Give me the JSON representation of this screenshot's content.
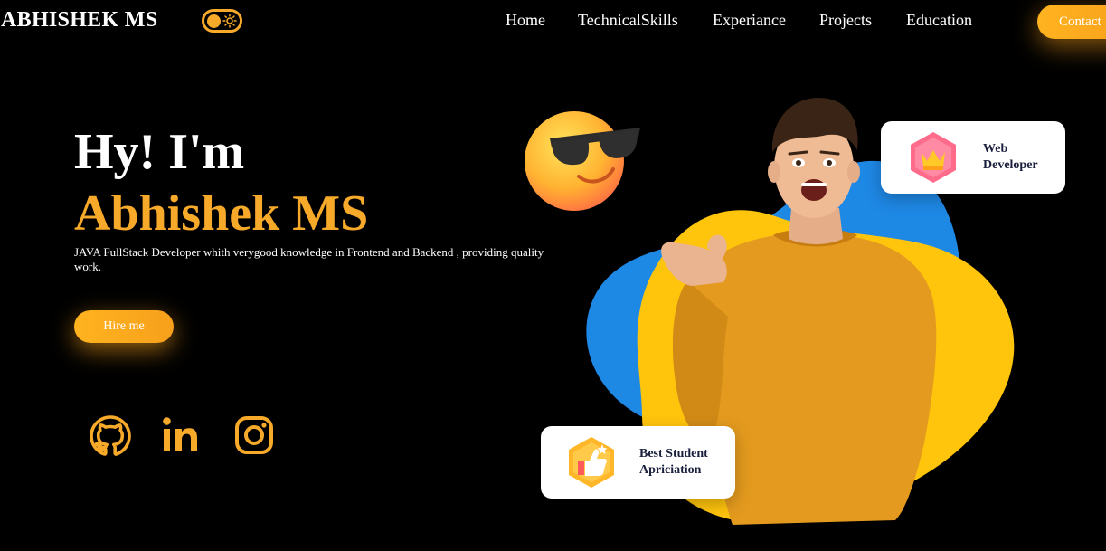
{
  "brand": "ABHISHEK MS",
  "nav": {
    "items": [
      "Home",
      "TechnicalSkills",
      "Experiance",
      "Projects",
      "Education"
    ],
    "contact_label": "Contact"
  },
  "hero": {
    "greeting": "Hy! I'm",
    "name": "Abhishek MS",
    "description": "JAVA FullStack Developer whith verygood knowledge in Frontend and Backend , providing quality work.",
    "hire_label": "Hire me"
  },
  "cards": {
    "web": "Web Developer",
    "student": "Best Student Apriciation"
  },
  "colors": {
    "accent": "#f7a92a",
    "background": "#000000",
    "blob_blue": "#1e88e5",
    "blob_yellow": "#ffc40c"
  },
  "icons": {
    "social": [
      "github-icon",
      "linkedin-icon",
      "instagram-icon"
    ],
    "theme": "sun-icon"
  }
}
